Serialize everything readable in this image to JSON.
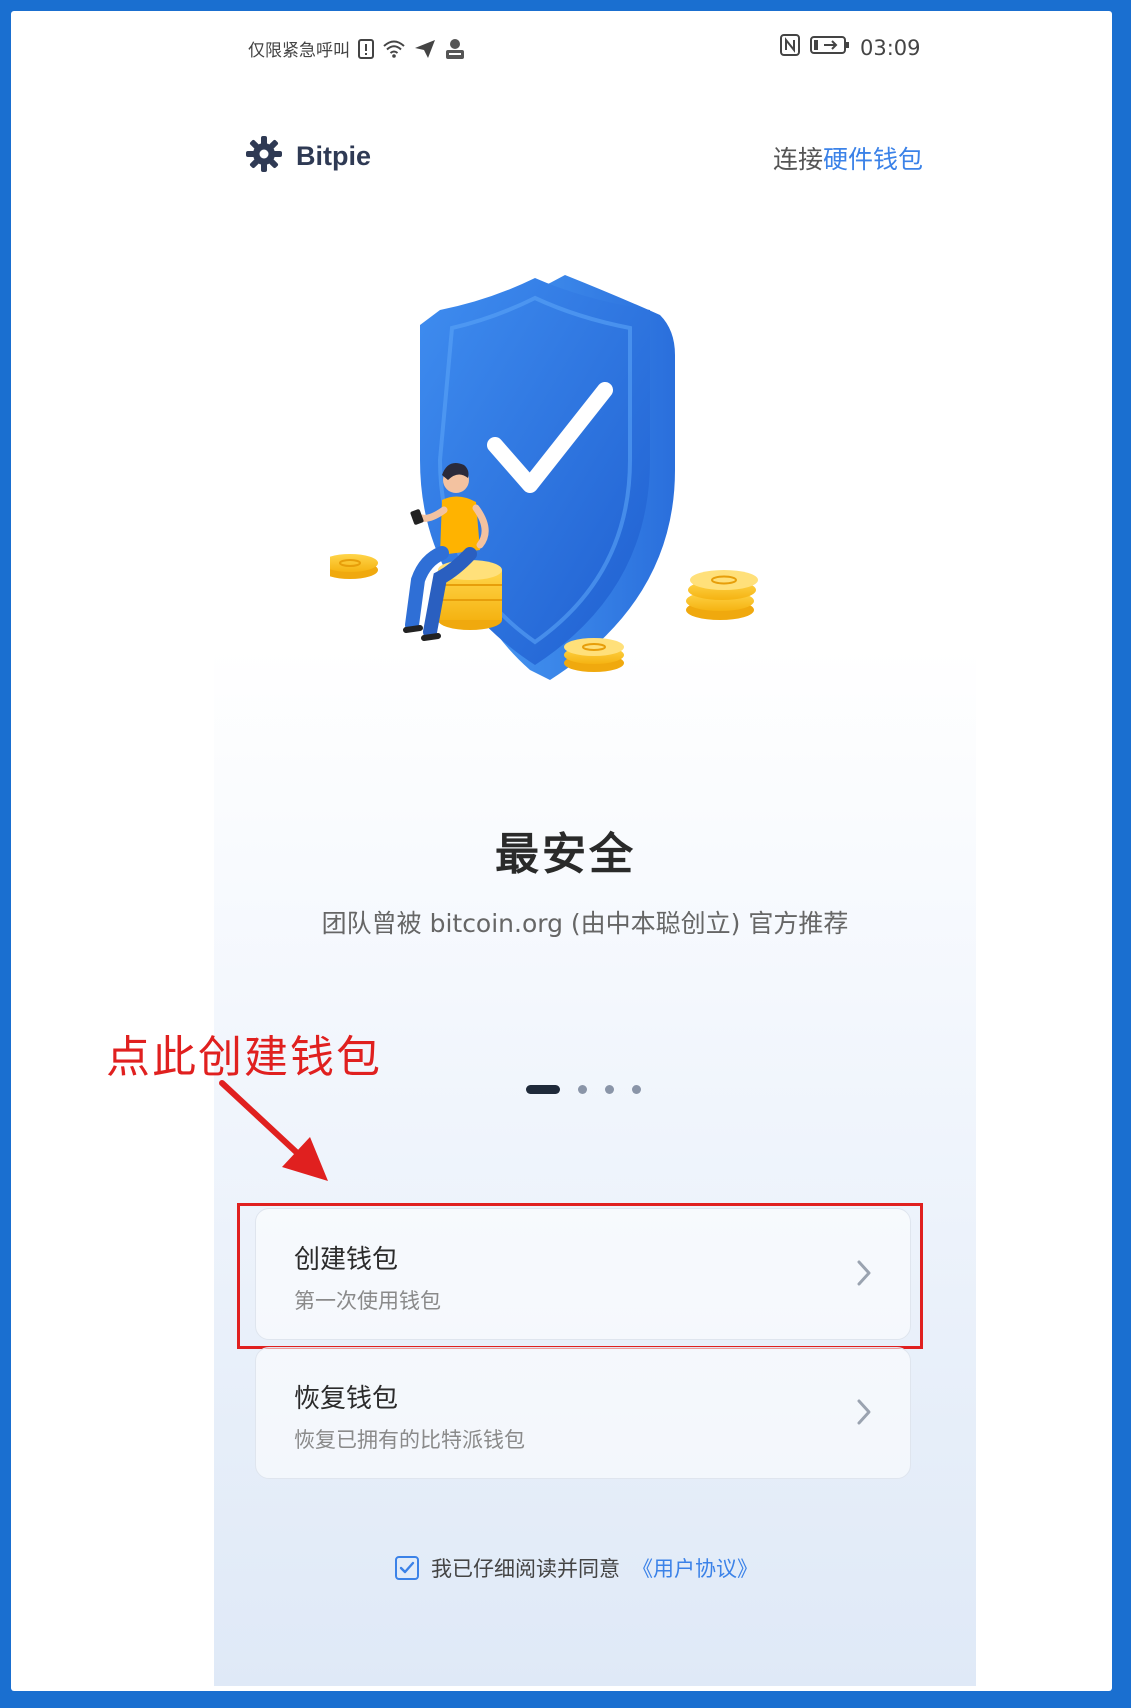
{
  "status_bar": {
    "carrier_text": "仅限紧急呼叫",
    "time": "03:09",
    "icons": [
      "sim-alert-icon",
      "wifi-icon",
      "send-icon",
      "user-badge-icon",
      "nfc-icon",
      "battery-icon"
    ]
  },
  "header": {
    "brand_name": "Bitpie",
    "brand_icon": "gear-icon",
    "hw_link_prefix": "连接",
    "hw_link_accent": "硬件钱包"
  },
  "onboarding": {
    "title": "最安全",
    "subtitle": "团队曾被 bitcoin.org (由中本聪创立) 官方推荐",
    "pager": {
      "total": 4,
      "active_index": 0
    }
  },
  "annotation": {
    "text": "点此创建钱包"
  },
  "options": [
    {
      "title": "创建钱包",
      "subtitle": "第一次使用钱包"
    },
    {
      "title": "恢复钱包",
      "subtitle": "恢复已拥有的比特派钱包"
    }
  ],
  "agreement": {
    "checked": true,
    "text": "我已仔细阅读并同意",
    "link": "《用户协议》"
  },
  "colors": {
    "accent": "#3b82e8",
    "annotation_red": "#e0201f",
    "frame_blue": "#1a6fd0"
  }
}
